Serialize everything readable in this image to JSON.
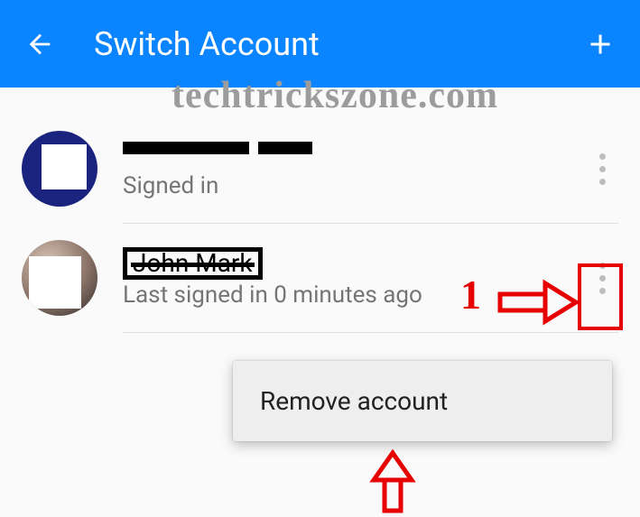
{
  "header": {
    "title": "Switch Account"
  },
  "watermark": "techtrickszone.com",
  "accounts": [
    {
      "name": "",
      "status": "Signed in"
    },
    {
      "name": "John Mark",
      "status": "Last signed in 0 minutes ago"
    }
  ],
  "popup": {
    "remove_label": "Remove account"
  },
  "annotations": {
    "step_number": "1"
  }
}
